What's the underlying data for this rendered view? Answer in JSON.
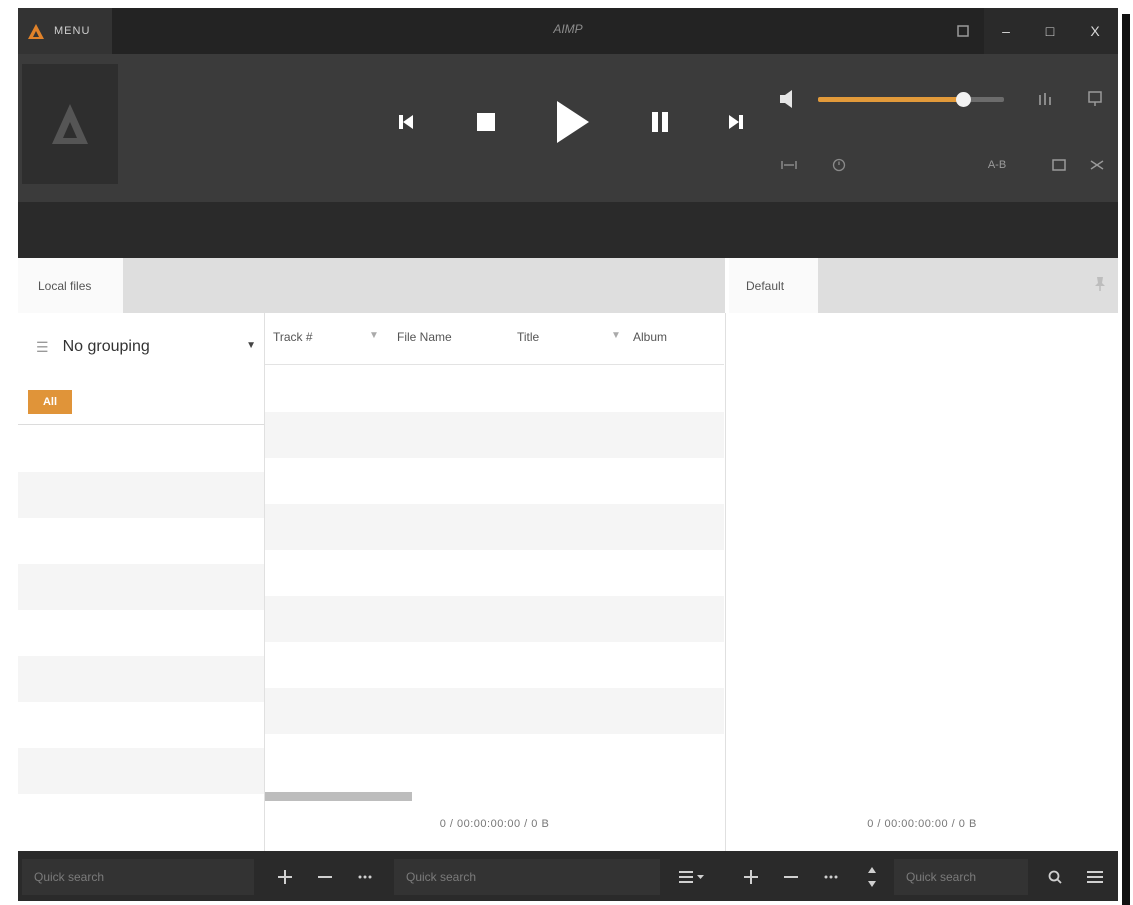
{
  "window": {
    "menu_label": "MENU",
    "title": "AIMP",
    "controls": {
      "minimize": "–",
      "maximize": "□",
      "close": "X"
    }
  },
  "player": {
    "volume_percent": 78,
    "extra_labels": {
      "ab": "A-B"
    },
    "icons": [
      "previous-icon",
      "stop-icon",
      "play-icon",
      "pause-icon",
      "next-icon",
      "volume-icon",
      "equalizer-icon",
      "visualization-icon",
      "crossfade-icon",
      "sleep-timer-icon",
      "repeat-icon",
      "shuffle-icon"
    ]
  },
  "library": {
    "tab_label": "Local files",
    "grouping_label": "No grouping",
    "all_label": "All",
    "columns": [
      "Track #",
      "File Name",
      "Title",
      "Album"
    ],
    "status": "0 / 00:00:00:00 / 0 B"
  },
  "playlist": {
    "tab_label": "Default",
    "status": "0 / 00:00:00:00 / 0 B"
  },
  "bottom": {
    "search_placeholder_left": "Quick search",
    "search_placeholder_mid": "Quick search",
    "search_placeholder_right": "Quick search"
  },
  "colors": {
    "accent": "#e09439",
    "window_bg": "#2b2b2b",
    "player_bg": "#3b3b3b"
  }
}
